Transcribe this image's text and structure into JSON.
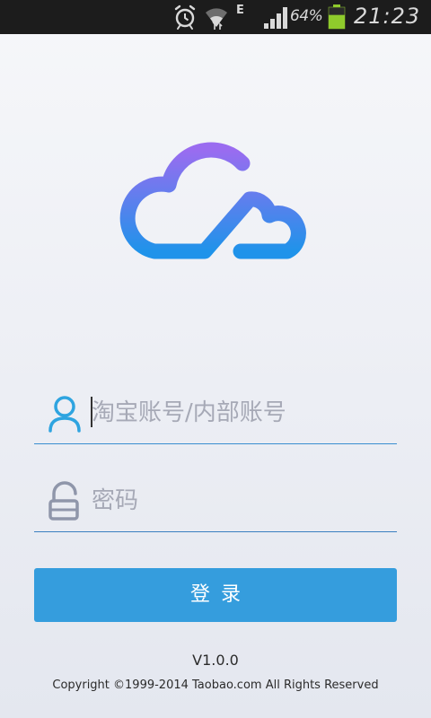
{
  "status_bar": {
    "icons": [
      "alarm-icon",
      "wifi-icon",
      "signal-icon",
      "battery-icon"
    ],
    "network_type": "E",
    "battery_percent": "64%",
    "battery_level": 0.64,
    "time": "21:23"
  },
  "logo": {
    "icon": "cloud-logo-icon",
    "gradient_top": "#9a6cf0",
    "gradient_bottom": "#1f93ea"
  },
  "login_form": {
    "account": {
      "icon": "user-icon",
      "value": "",
      "placeholder": "淘宝账号/内部账号"
    },
    "password": {
      "icon": "lock-icon",
      "value": "",
      "placeholder": "密码"
    },
    "login_button_label": "登录"
  },
  "footer": {
    "version": "V1.0.0",
    "copyright": "Copyright ©1999-2014 Taobao.com All Rights Reserved"
  },
  "colors": {
    "accent": "#359ddd",
    "field_underline": "#3a8ed0",
    "status_bar_bg": "#1c1c1c"
  }
}
